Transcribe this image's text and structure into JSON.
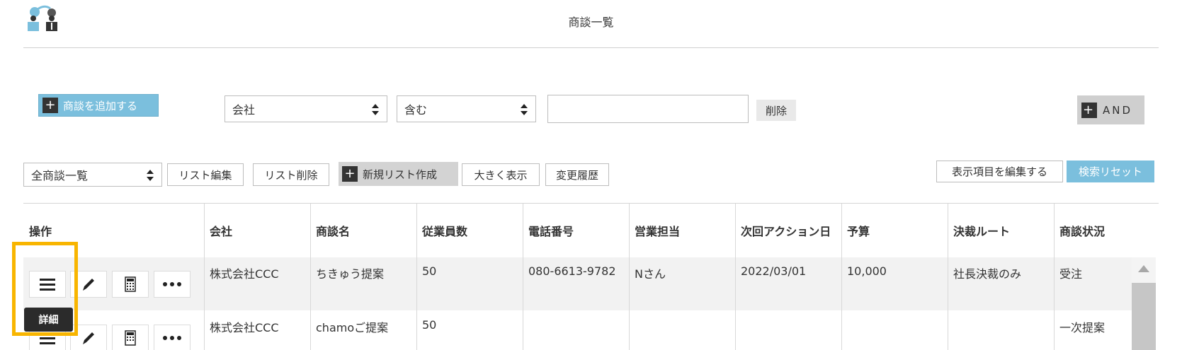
{
  "header": {
    "title": "商談一覧"
  },
  "toolbar": {
    "add_label": "商談を追加する",
    "filter_field": "会社",
    "filter_operator": "含む",
    "filter_value": "",
    "delete_label": "削除",
    "and_label": "AND"
  },
  "list_bar": {
    "list_select": "全商談一覧",
    "edit_list": "リスト編集",
    "delete_list": "リスト削除",
    "new_list": "新規リスト作成",
    "large_view": "大きく表示",
    "history": "変更履歴",
    "edit_columns": "表示項目を編集する",
    "search_reset": "検索リセット"
  },
  "table": {
    "columns": [
      "操作",
      "会社",
      "商談名",
      "従業員数",
      "電話番号",
      "営業担当",
      "次回アクション日",
      "予算",
      "決裁ルート",
      "商談状況"
    ],
    "rows": [
      [
        "株式会社CCC",
        "ちきゅう提案",
        "50",
        "080-6613-9782",
        "Nさん",
        "2022/03/01",
        "10,000",
        "社長決裁のみ",
        "受注"
      ],
      [
        "株式会社CCC",
        "chamoご提案",
        "50",
        "",
        "",
        "",
        "",
        "",
        "一次提案"
      ]
    ]
  },
  "tooltip": {
    "label": "詳細"
  },
  "icons": [
    "logo-icon",
    "plus-icon",
    "menu-icon",
    "pencil-icon",
    "calculator-icon",
    "more-icon",
    "scroll-up-icon"
  ]
}
